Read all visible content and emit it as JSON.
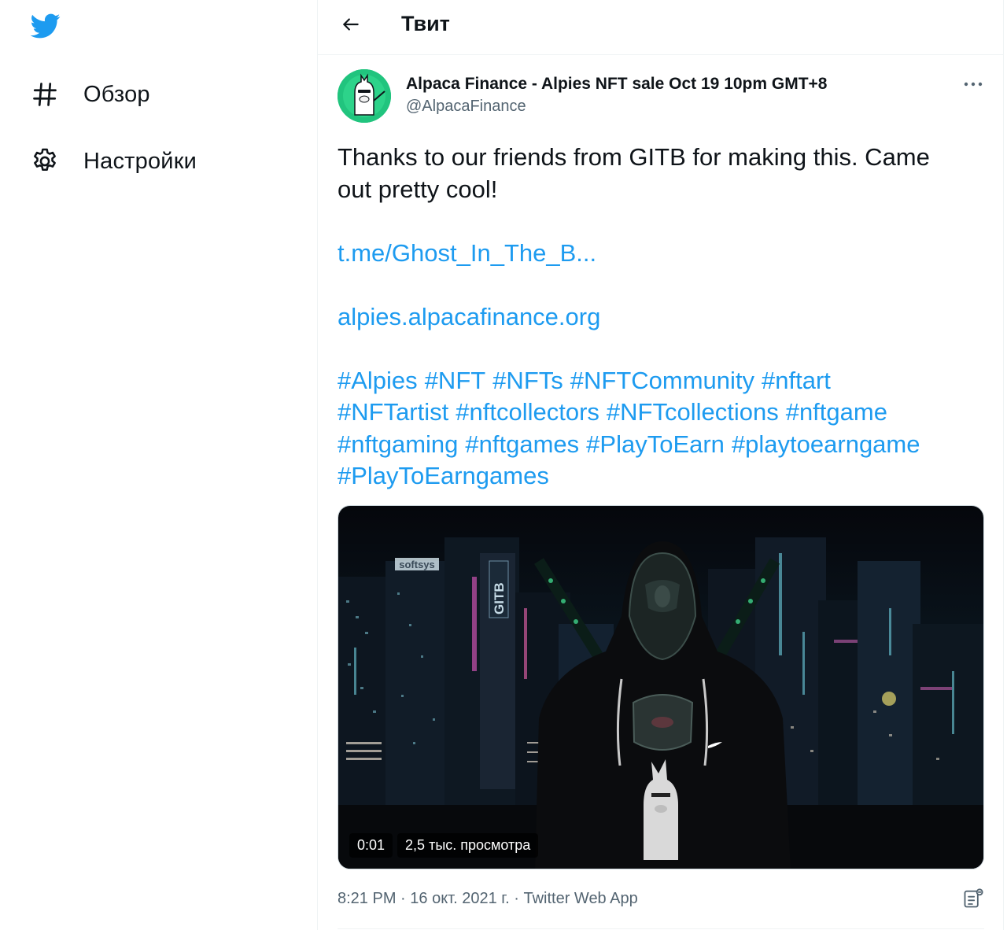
{
  "colors": {
    "brand": "#1d9bf0",
    "text": "#0f1419",
    "muted": "#536471"
  },
  "sidebar": {
    "logo_icon": "twitter-bird-icon",
    "items": [
      {
        "label": "Обзор",
        "icon": "hashtag-icon"
      },
      {
        "label": "Настройки",
        "icon": "gear-icon"
      }
    ]
  },
  "header": {
    "title": "Твит",
    "back_icon": "arrow-left-icon"
  },
  "tweet": {
    "author_name": "Alpaca Finance - Alpies NFT sale Oct 19 10pm GMT+8",
    "author_handle": "@AlpacaFinance",
    "more_icon": "more-dots-icon",
    "text_lines": [
      "Thanks to our friends from GITB for making this. Came",
      "out pretty cool!"
    ],
    "link1": "t.me/Ghost_In_The_B...",
    "link2": "alpies.alpacafinance.org",
    "hashtags": [
      "#Alpies",
      "#NFT",
      "#NFTs",
      "#NFTCommunity",
      "#nftart",
      "#NFTartist",
      "#nftcollectors",
      "#NFTcollections",
      "#nftgame",
      "#nftgaming",
      "#nftgames",
      "#PlayToEarn",
      "#playtoearngame",
      "#PlayToEarngames"
    ],
    "video": {
      "duration": "0:01",
      "views": "2,5 тыс. просмотра",
      "sign_text": "GITB",
      "store_sign": "softsys"
    },
    "time": "8:21 PM",
    "date": "16 окт. 2021 г.",
    "source": "Twitter Web App",
    "analytics_icon": "analytics-icon"
  }
}
